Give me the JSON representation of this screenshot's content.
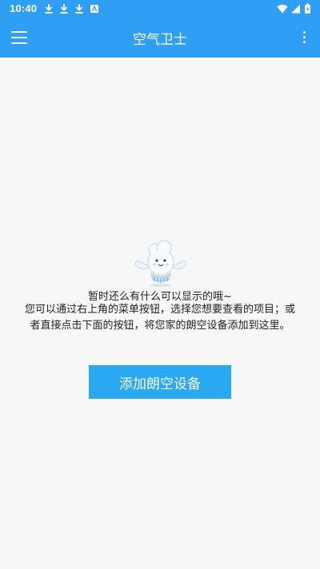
{
  "status_bar": {
    "time": "10:40",
    "icons": [
      "download-icon",
      "download-icon",
      "download-icon",
      "app-notification-icon",
      "wifi-icon",
      "cellular-signal-icon",
      "battery-icon"
    ]
  },
  "app_bar": {
    "title": "空气卫士",
    "menu_icon": "hamburger-menu-icon",
    "more_icon": "more-vert-icon"
  },
  "empty_state": {
    "line1": "暂时还么有什么可以显示的哦~",
    "line2": "您可以通过右上角的菜单按钮，选择您想要查看的项目；或者直接点击下面的按钮，将您家的朗空设备添加到这里。",
    "button_label": "添加朗空设备"
  },
  "colors": {
    "primary": "#2f9ff5",
    "button": "#2aa8f2",
    "background": "#f7f7f7",
    "text": "#222222"
  }
}
